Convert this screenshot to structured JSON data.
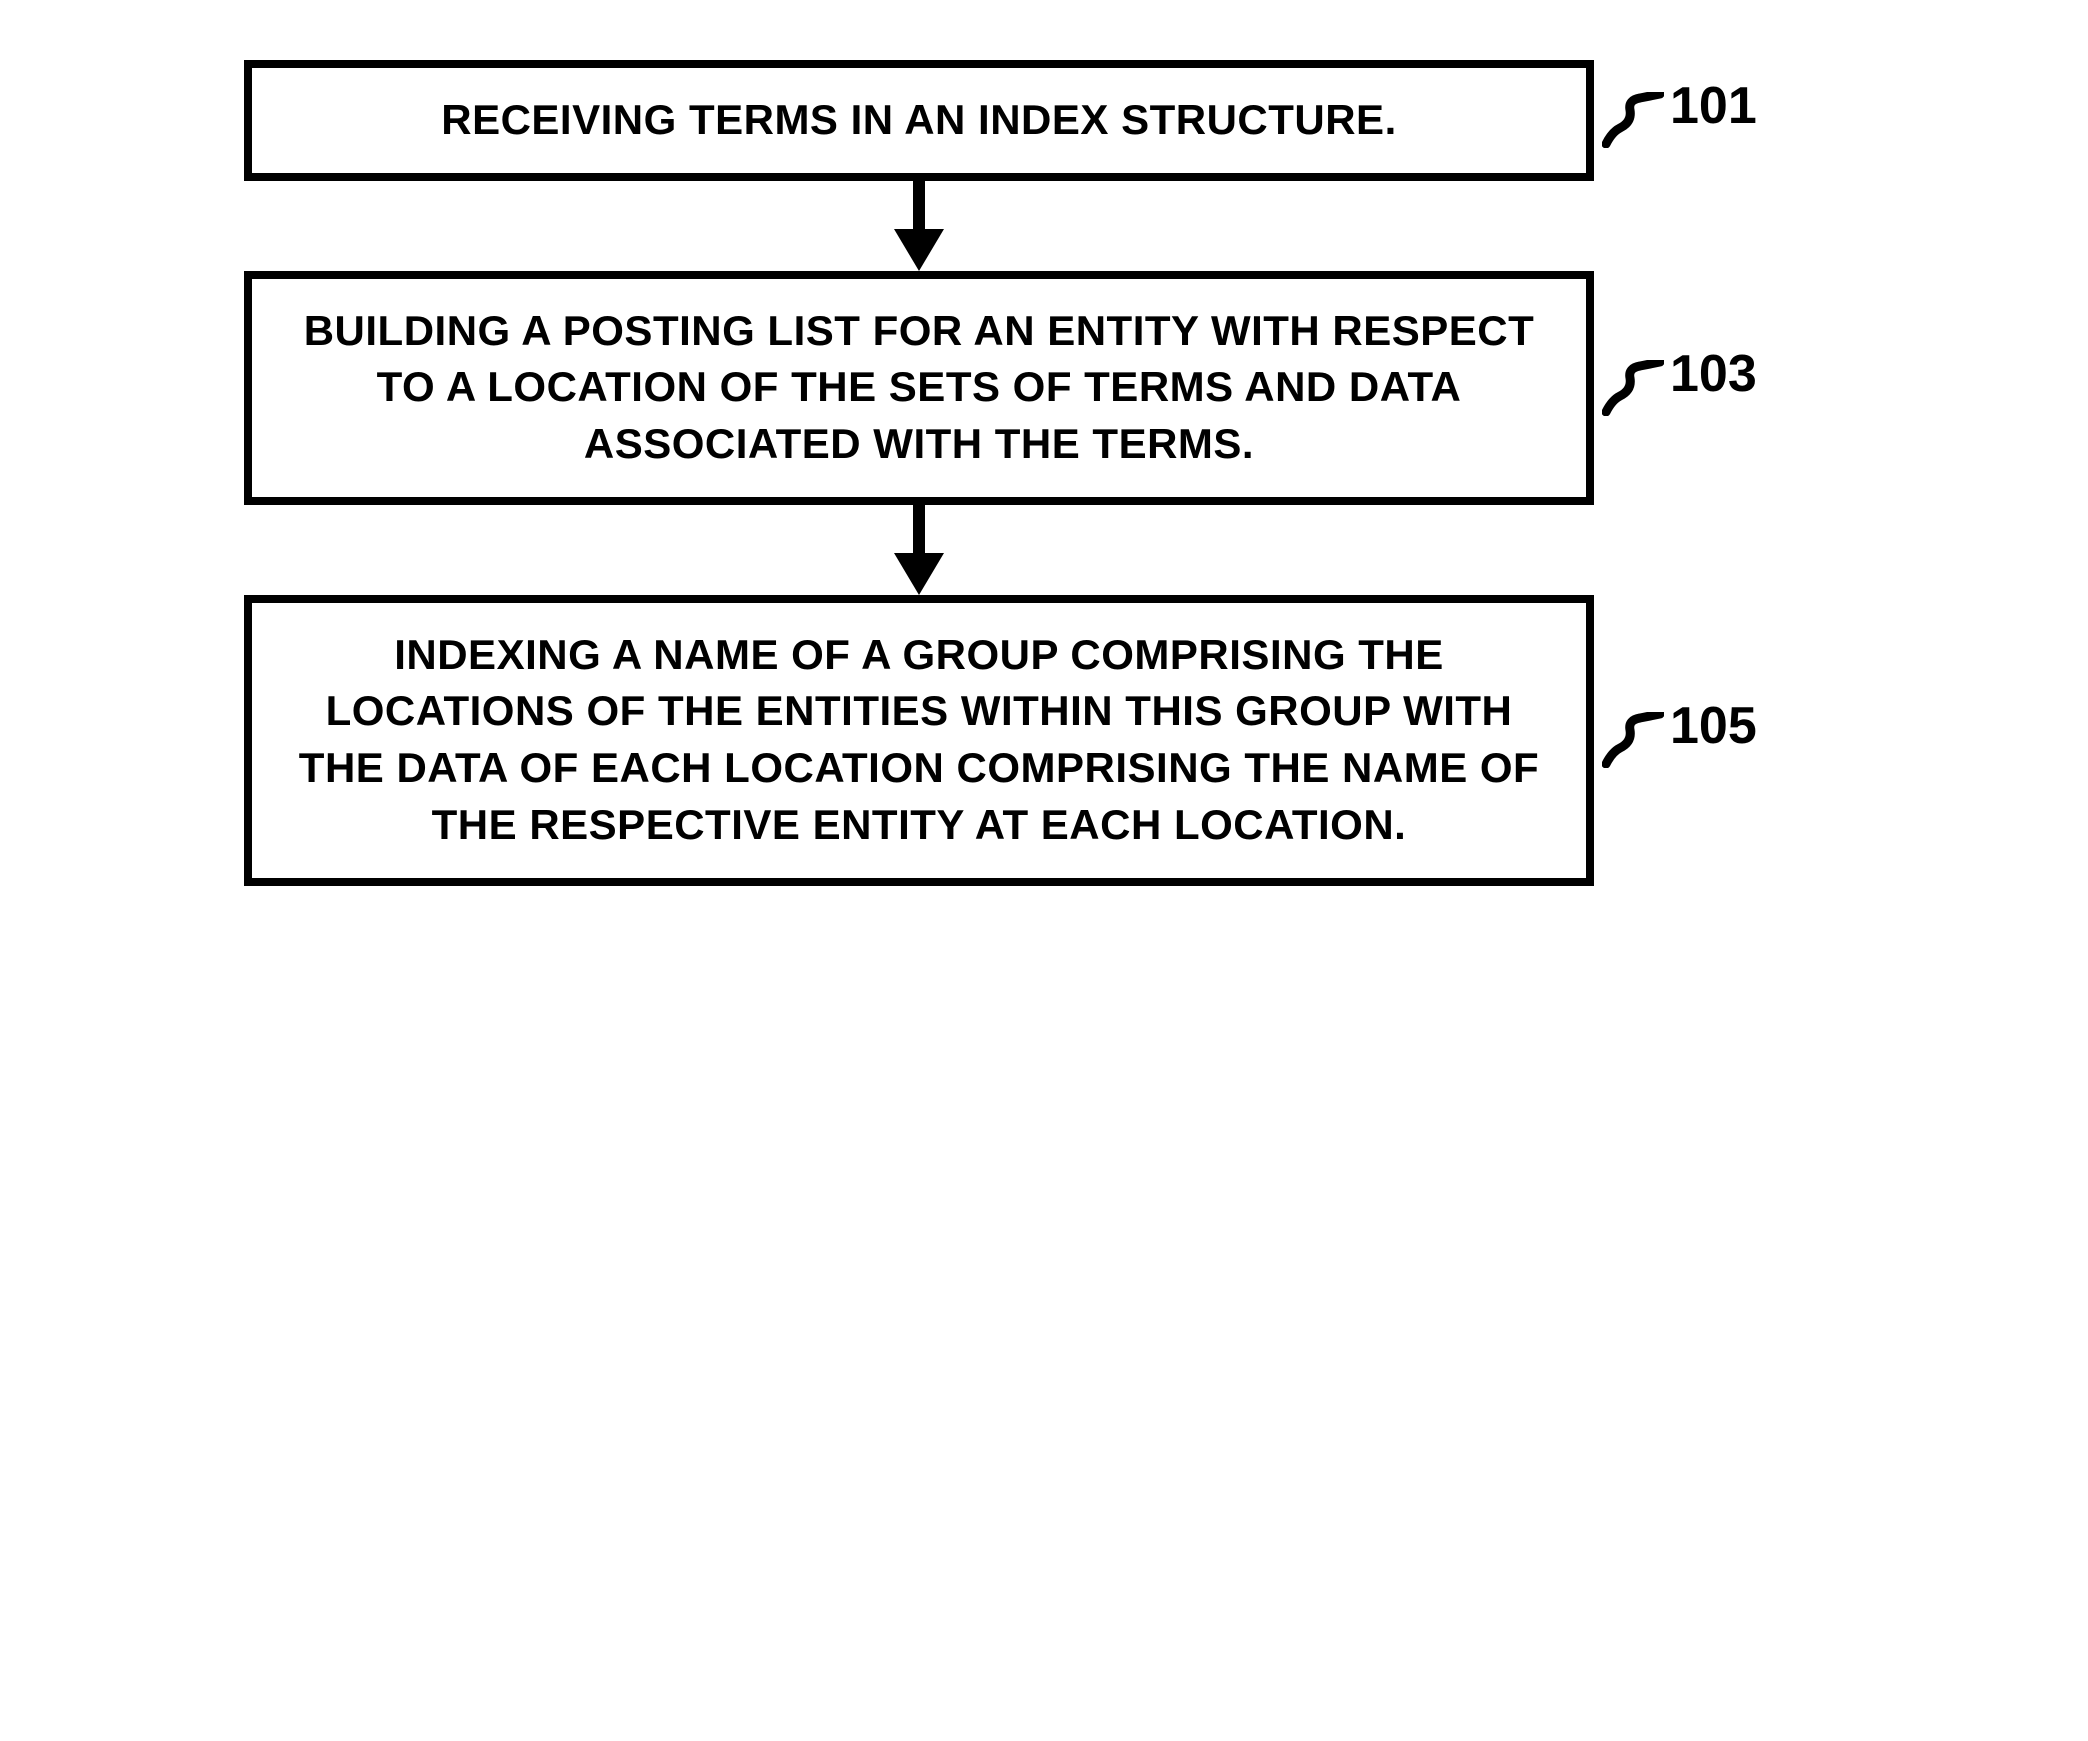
{
  "steps": [
    {
      "text": "RECEIVING TERMS IN AN INDEX STRUCTURE.",
      "label": "101"
    },
    {
      "text": "BUILDING A POSTING LIST FOR AN ENTITY WITH RESPECT TO A LOCATION OF THE SETS OF TERMS AND DATA ASSOCIATED WITH THE TERMS.",
      "label": "103"
    },
    {
      "text": "INDEXING A NAME OF A GROUP COMPRISING THE LOCATIONS OF THE ENTITIES WITHIN THIS GROUP WITH THE DATA OF EACH LOCATION COMPRISING THE NAME OF THE RESPECTIVE ENTITY AT EACH LOCATION.",
      "label": "105"
    }
  ]
}
